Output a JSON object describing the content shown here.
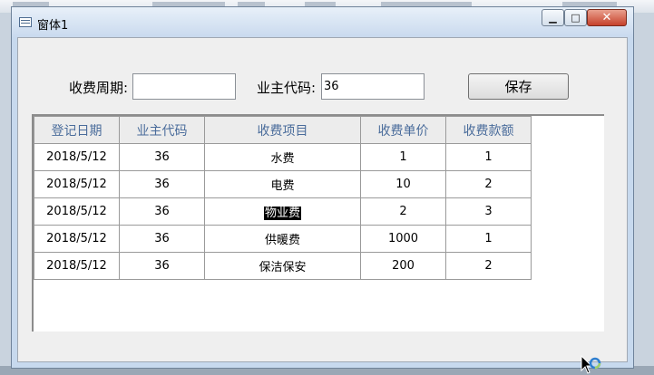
{
  "window": {
    "title": "窗体1",
    "minimize_glyph": "▁",
    "maximize_glyph": "□",
    "close_glyph": "✕"
  },
  "form": {
    "period_label": "收费周期:",
    "period_value": "",
    "owner_label": "业主代码:",
    "owner_value": "36",
    "save_label": "保存"
  },
  "grid": {
    "columns": [
      "登记日期",
      "业主代码",
      "收费项目",
      "收费单价",
      "收费款额"
    ],
    "rows": [
      [
        "2018/5/12",
        "36",
        "水费",
        "1",
        "1"
      ],
      [
        "2018/5/12",
        "36",
        "电费",
        "10",
        "2"
      ],
      [
        "2018/5/12",
        "36",
        "物业费",
        "2",
        "3"
      ],
      [
        "2018/5/12",
        "36",
        "供暖费",
        "1000",
        "1"
      ],
      [
        "2018/5/12",
        "36",
        "保洁保安",
        "200",
        "2"
      ]
    ],
    "selected_cell_text": "物业费"
  },
  "colors": {
    "header_text": "#4a6c9b",
    "close_button": "#c6412b"
  }
}
